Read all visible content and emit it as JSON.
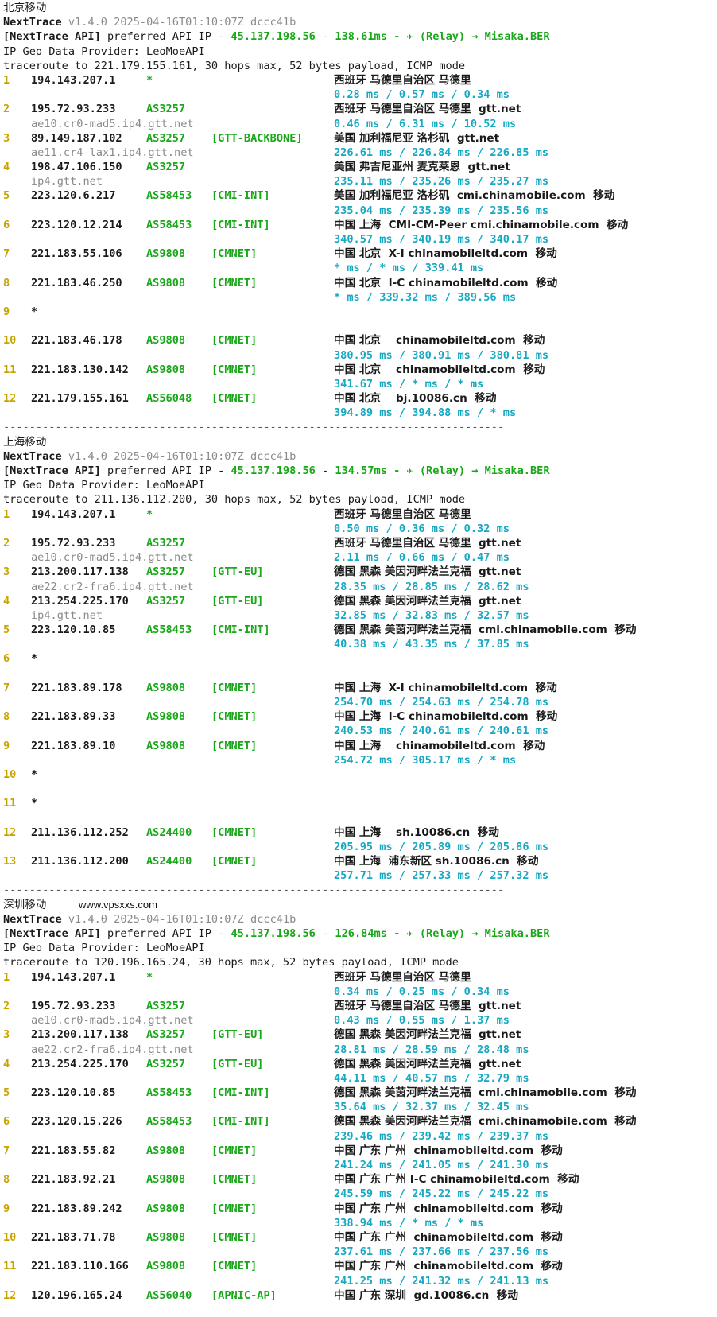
{
  "sections": [
    {
      "title": "北京移动",
      "watermark": "",
      "nt_name": "NextTrace",
      "nt_version": "v1.4.0 2025-04-16T01:10:07Z dccc41b",
      "api_prefix": "[NextTrace API]",
      "api_text": " preferred API IP - ",
      "api_ip": "45.137.198.56",
      "api_dash": " - ",
      "api_latency": "138.61ms",
      "api_relay": " - ✈ (Relay) → Misaka.BER",
      "geo_provider": "IP Geo Data Provider: LeoMoeAPI",
      "traceroute": "traceroute to 221.179.155.161, 30 hops max, 52 bytes payload, ICMP mode",
      "hops": [
        {
          "n": "1",
          "ip": "194.143.207.1",
          "asn": "*",
          "tag": "",
          "geo": "西班牙 马德里自治区 马德里",
          "host": "",
          "rtt": "0.28 ms / 0.57 ms / 0.34 ms"
        },
        {
          "n": "2",
          "ip": "195.72.93.233",
          "asn": "AS3257",
          "tag": "",
          "geo": "西班牙 马德里自治区 马德里  gtt.net",
          "host": "ae10.cr0-mad5.ip4.gtt.net",
          "rtt": "0.46 ms / 6.31 ms / 10.52 ms"
        },
        {
          "n": "3",
          "ip": "89.149.187.102",
          "asn": "AS3257",
          "tag": "[GTT-BACKBONE]",
          "geo": "美国 加利福尼亚 洛杉矶  gtt.net",
          "host": "ae11.cr4-lax1.ip4.gtt.net",
          "rtt": "226.61 ms / 226.84 ms / 226.85 ms"
        },
        {
          "n": "4",
          "ip": "198.47.106.150",
          "asn": "AS3257",
          "tag": "",
          "geo": "美国 弗吉尼亚州 麦克莱恩  gtt.net",
          "host": "ip4.gtt.net",
          "rtt": "235.11 ms / 235.26 ms / 235.27 ms"
        },
        {
          "n": "5",
          "ip": "223.120.6.217",
          "asn": "AS58453",
          "tag": "[CMI-INT]",
          "geo": "美国 加利福尼亚 洛杉矶  cmi.chinamobile.com  移动",
          "host": "",
          "rtt": "235.04 ms / 235.39 ms / 235.56 ms"
        },
        {
          "n": "6",
          "ip": "223.120.12.214",
          "asn": "AS58453",
          "tag": "[CMI-INT]",
          "geo": "中国 上海  CMI-CM-Peer cmi.chinamobile.com  移动",
          "host": "",
          "rtt": "340.57 ms / 340.19 ms / 340.17 ms"
        },
        {
          "n": "7",
          "ip": "221.183.55.106",
          "asn": "AS9808",
          "tag": "[CMNET]",
          "geo": "中国 北京  X-I chinamobileltd.com  移动",
          "host": "",
          "rtt": "* ms / * ms / 339.41 ms"
        },
        {
          "n": "8",
          "ip": "221.183.46.250",
          "asn": "AS9808",
          "tag": "[CMNET]",
          "geo": "中国 北京  I-C chinamobileltd.com  移动",
          "host": "",
          "rtt": "* ms / 339.32 ms / 389.56 ms"
        },
        {
          "n": "9",
          "ip": "*",
          "asn": "",
          "tag": "",
          "geo": "",
          "host": "",
          "rtt": ""
        },
        {
          "n": "10",
          "ip": "221.183.46.178",
          "asn": "AS9808",
          "tag": "[CMNET]",
          "geo": "中国 北京    chinamobileltd.com  移动",
          "host": "",
          "rtt": "380.95 ms / 380.91 ms / 380.81 ms"
        },
        {
          "n": "11",
          "ip": "221.183.130.142",
          "asn": "AS9808",
          "tag": "[CMNET]",
          "geo": "中国 北京    chinamobileltd.com  移动",
          "host": "",
          "rtt": "341.67 ms / * ms / * ms"
        },
        {
          "n": "12",
          "ip": "221.179.155.161",
          "asn": "AS56048",
          "tag": "[CMNET]",
          "geo": "中国 北京    bj.10086.cn  移动",
          "host": "",
          "rtt": "394.89 ms / 394.88 ms / * ms"
        }
      ],
      "separator": "-----------------------------------------------------------------------------"
    },
    {
      "title": "上海移动",
      "watermark": "",
      "nt_name": "NextTrace",
      "nt_version": "v1.4.0 2025-04-16T01:10:07Z dccc41b",
      "api_prefix": "[NextTrace API]",
      "api_text": " preferred API IP - ",
      "api_ip": "45.137.198.56",
      "api_dash": " - ",
      "api_latency": "134.57ms",
      "api_relay": " - ✈ (Relay) → Misaka.BER",
      "geo_provider": "IP Geo Data Provider: LeoMoeAPI",
      "traceroute": "traceroute to 211.136.112.200, 30 hops max, 52 bytes payload, ICMP mode",
      "hops": [
        {
          "n": "1",
          "ip": "194.143.207.1",
          "asn": "*",
          "tag": "",
          "geo": "西班牙 马德里自治区 马德里",
          "host": "",
          "rtt": "0.50 ms / 0.36 ms / 0.32 ms"
        },
        {
          "n": "2",
          "ip": "195.72.93.233",
          "asn": "AS3257",
          "tag": "",
          "geo": "西班牙 马德里自治区 马德里  gtt.net",
          "host": "ae10.cr0-mad5.ip4.gtt.net",
          "rtt": "2.11 ms / 0.66 ms / 0.47 ms"
        },
        {
          "n": "3",
          "ip": "213.200.117.138",
          "asn": "AS3257",
          "tag": "[GTT-EU]",
          "geo": "德国 黑森 美因河畔法兰克福  gtt.net",
          "host": "ae22.cr2-fra6.ip4.gtt.net",
          "rtt": "28.35 ms / 28.85 ms / 28.62 ms"
        },
        {
          "n": "4",
          "ip": "213.254.225.170",
          "asn": "AS3257",
          "tag": "[GTT-EU]",
          "geo": "德国 黑森 美因河畔法兰克福  gtt.net",
          "host": "ip4.gtt.net",
          "rtt": "32.85 ms / 32.83 ms / 32.57 ms"
        },
        {
          "n": "5",
          "ip": "223.120.10.85",
          "asn": "AS58453",
          "tag": "[CMI-INT]",
          "geo": "德国 黑森 美茵河畔法兰克福  cmi.chinamobile.com  移动",
          "host": "",
          "rtt": "40.38 ms / 43.35 ms / 37.85 ms"
        },
        {
          "n": "6",
          "ip": "*",
          "asn": "",
          "tag": "",
          "geo": "",
          "host": "",
          "rtt": ""
        },
        {
          "n": "7",
          "ip": "221.183.89.178",
          "asn": "AS9808",
          "tag": "[CMNET]",
          "geo": "中国 上海  X-I chinamobileltd.com  移动",
          "host": "",
          "rtt": "254.70 ms / 254.63 ms / 254.78 ms"
        },
        {
          "n": "8",
          "ip": "221.183.89.33",
          "asn": "AS9808",
          "tag": "[CMNET]",
          "geo": "中国 上海  I-C chinamobileltd.com  移动",
          "host": "",
          "rtt": "240.53 ms / 240.61 ms / 240.61 ms"
        },
        {
          "n": "9",
          "ip": "221.183.89.10",
          "asn": "AS9808",
          "tag": "[CMNET]",
          "geo": "中国 上海    chinamobileltd.com  移动",
          "host": "",
          "rtt": "254.72 ms / 305.17 ms / * ms"
        },
        {
          "n": "10",
          "ip": "*",
          "asn": "",
          "tag": "",
          "geo": "",
          "host": "",
          "rtt": ""
        },
        {
          "n": "11",
          "ip": "*",
          "asn": "",
          "tag": "",
          "geo": "",
          "host": "",
          "rtt": ""
        },
        {
          "n": "12",
          "ip": "211.136.112.252",
          "asn": "AS24400",
          "tag": "[CMNET]",
          "geo": "中国 上海    sh.10086.cn  移动",
          "host": "",
          "rtt": "205.95 ms / 205.89 ms / 205.86 ms"
        },
        {
          "n": "13",
          "ip": "211.136.112.200",
          "asn": "AS24400",
          "tag": "[CMNET]",
          "geo": "中国 上海  浦东新区 sh.10086.cn  移动",
          "host": "",
          "rtt": "257.71 ms / 257.33 ms / 257.32 ms"
        }
      ],
      "separator": "-----------------------------------------------------------------------------"
    },
    {
      "title": "深圳移动",
      "watermark": "www.vpsxxs.com",
      "nt_name": "NextTrace",
      "nt_version": "v1.4.0 2025-04-16T01:10:07Z dccc41b",
      "api_prefix": "[NextTrace API]",
      "api_text": " preferred API IP - ",
      "api_ip": "45.137.198.56",
      "api_dash": " - ",
      "api_latency": "126.84ms",
      "api_relay": " - ✈ (Relay) → Misaka.BER",
      "geo_provider": "IP Geo Data Provider: LeoMoeAPI",
      "traceroute": "traceroute to 120.196.165.24, 30 hops max, 52 bytes payload, ICMP mode",
      "hops": [
        {
          "n": "1",
          "ip": "194.143.207.1",
          "asn": "*",
          "tag": "",
          "geo": "西班牙 马德里自治区 马德里",
          "host": "",
          "rtt": "0.34 ms / 0.25 ms / 0.34 ms"
        },
        {
          "n": "2",
          "ip": "195.72.93.233",
          "asn": "AS3257",
          "tag": "",
          "geo": "西班牙 马德里自治区 马德里  gtt.net",
          "host": "ae10.cr0-mad5.ip4.gtt.net",
          "rtt": "0.43 ms / 0.55 ms / 1.37 ms"
        },
        {
          "n": "3",
          "ip": "213.200.117.138",
          "asn": "AS3257",
          "tag": "[GTT-EU]",
          "geo": "德国 黑森 美因河畔法兰克福  gtt.net",
          "host": "ae22.cr2-fra6.ip4.gtt.net",
          "rtt": "28.81 ms / 28.59 ms / 28.48 ms"
        },
        {
          "n": "4",
          "ip": "213.254.225.170",
          "asn": "AS3257",
          "tag": "[GTT-EU]",
          "geo": "德国 黑森 美因河畔法兰克福  gtt.net",
          "host": "",
          "rtt": "44.11 ms / 40.57 ms / 32.79 ms"
        },
        {
          "n": "5",
          "ip": "223.120.10.85",
          "asn": "AS58453",
          "tag": "[CMI-INT]",
          "geo": "德国 黑森 美茵河畔法兰克福  cmi.chinamobile.com  移动",
          "host": "",
          "rtt": "35.64 ms / 32.37 ms / 32.45 ms"
        },
        {
          "n": "6",
          "ip": "223.120.15.226",
          "asn": "AS58453",
          "tag": "[CMI-INT]",
          "geo": "德国 黑森 美因河畔法兰克福  cmi.chinamobile.com  移动",
          "host": "",
          "rtt": "239.46 ms / 239.42 ms / 239.37 ms"
        },
        {
          "n": "7",
          "ip": "221.183.55.82",
          "asn": "AS9808",
          "tag": "[CMNET]",
          "geo": "中国 广东 广州  chinamobileltd.com  移动",
          "host": "",
          "rtt": "241.24 ms / 241.05 ms / 241.30 ms"
        },
        {
          "n": "8",
          "ip": "221.183.92.21",
          "asn": "AS9808",
          "tag": "[CMNET]",
          "geo": "中国 广东 广州 I-C chinamobileltd.com  移动",
          "host": "",
          "rtt": "245.59 ms / 245.22 ms / 245.22 ms"
        },
        {
          "n": "9",
          "ip": "221.183.89.242",
          "asn": "AS9808",
          "tag": "[CMNET]",
          "geo": "中国 广东 广州  chinamobileltd.com  移动",
          "host": "",
          "rtt": "338.94 ms / * ms / * ms"
        },
        {
          "n": "10",
          "ip": "221.183.71.78",
          "asn": "AS9808",
          "tag": "[CMNET]",
          "geo": "中国 广东 广州  chinamobileltd.com  移动",
          "host": "",
          "rtt": "237.61 ms / 237.66 ms / 237.56 ms"
        },
        {
          "n": "11",
          "ip": "221.183.110.166",
          "asn": "AS9808",
          "tag": "[CMNET]",
          "geo": "中国 广东 广州  chinamobileltd.com  移动",
          "host": "",
          "rtt": "241.25 ms / 241.32 ms / 241.13 ms"
        },
        {
          "n": "12",
          "ip": "120.196.165.24",
          "asn": "AS56040",
          "tag": "[APNIC-AP]",
          "geo": "中国 广东 深圳  gd.10086.cn  移动",
          "host": "",
          "rtt": ""
        }
      ],
      "separator": ""
    }
  ]
}
